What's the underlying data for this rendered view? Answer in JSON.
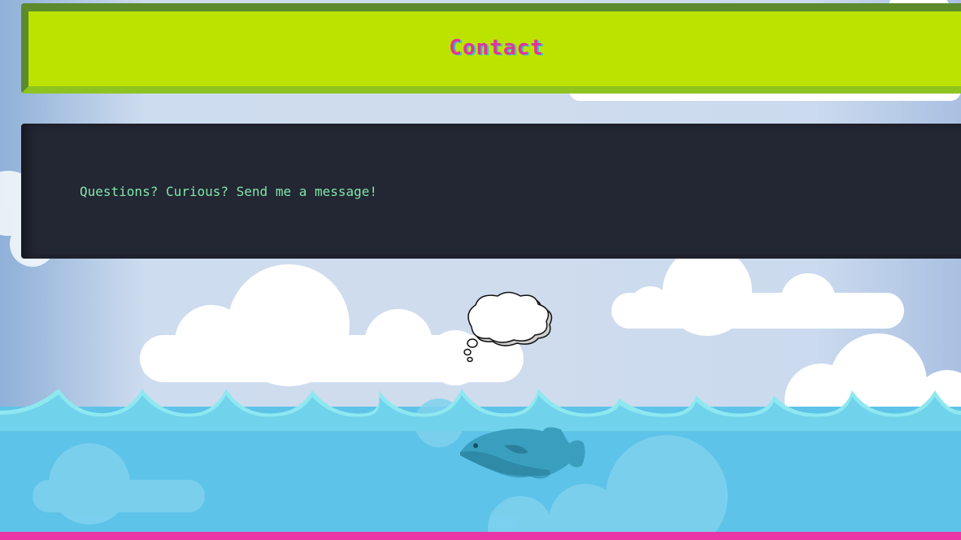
{
  "header": {
    "title": "Contact"
  },
  "panel": {
    "message": "Questions? Curious? Send me a message!"
  },
  "colors": {
    "header_bg": "#bce300",
    "header_border": "#5c8a2c",
    "title": "#e8329a",
    "panel_bg": "#232633",
    "panel_text": "#7fe8a8",
    "water": "#5ec3e8",
    "accent_bar": "#ea35a6"
  },
  "decorations": [
    "cloud-icon",
    "thought-bubble-icon",
    "fish-icon",
    "wave-icon"
  ]
}
